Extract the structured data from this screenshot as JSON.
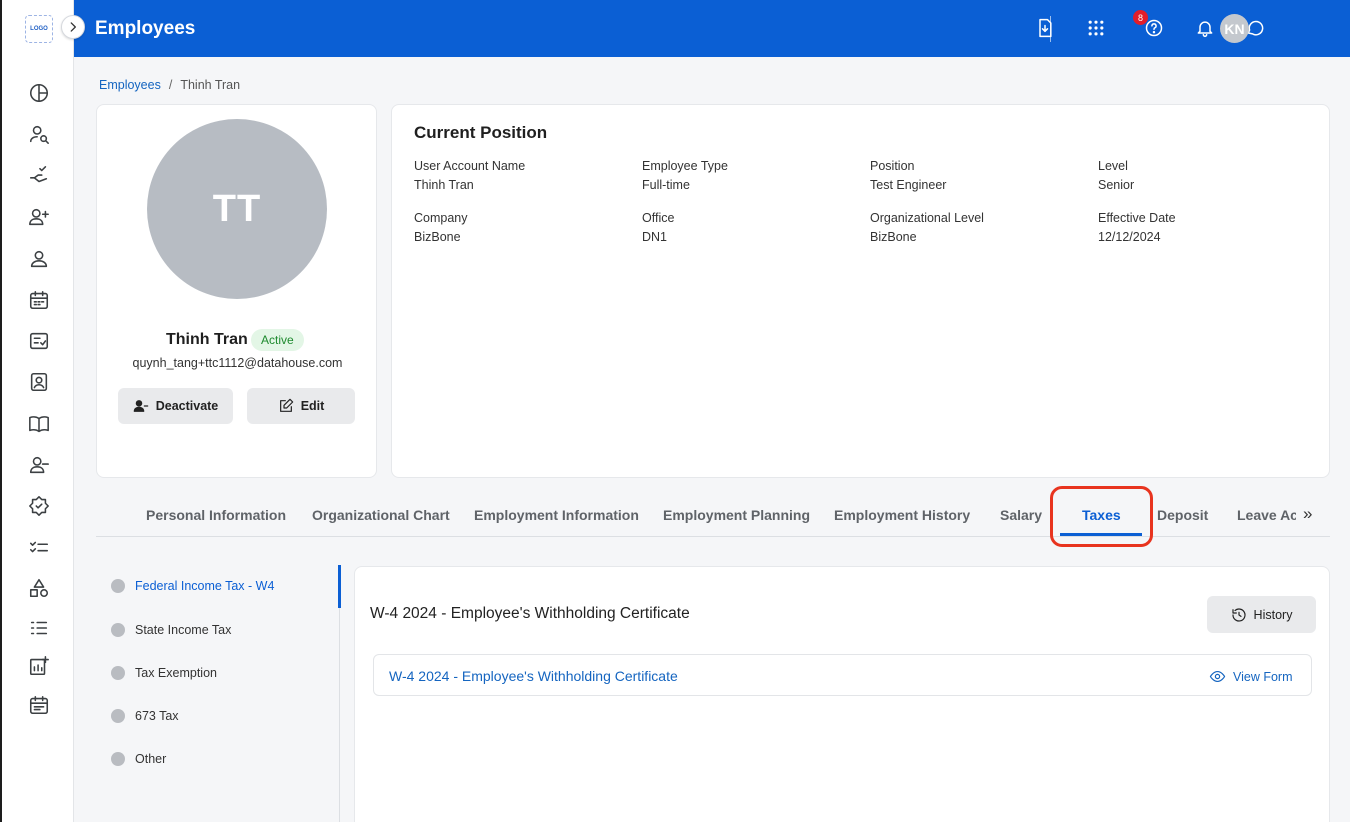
{
  "app": {
    "logo_text": "LOGO",
    "page_title": "Employees",
    "notification_count": "8",
    "user_initials": "KN"
  },
  "sidebar": {
    "icons": [
      "dashboard-icon",
      "user-search-icon",
      "approval-icon",
      "add-user-icon",
      "user-icon",
      "calendar-icon",
      "checklist-icon",
      "id-card-icon",
      "book-icon",
      "remove-user-icon",
      "badge-icon",
      "task-list-icon",
      "shapes-icon",
      "list-check-icon",
      "report-add-icon",
      "schedule-icon"
    ]
  },
  "breadcrumb": {
    "root": "Employees",
    "separator": "/",
    "current": "Thinh Tran"
  },
  "profile": {
    "initials": "TT",
    "name": "Thinh Tran",
    "status": "Active",
    "email": "quynh_tang+ttc1112@datahouse.com",
    "deactivate_label": "Deactivate",
    "edit_label": "Edit"
  },
  "position": {
    "title": "Current Position",
    "fields": [
      {
        "label": "User Account Name",
        "value": "Thinh Tran"
      },
      {
        "label": "Employee Type",
        "value": "Full-time"
      },
      {
        "label": "Position",
        "value": "Test Engineer"
      },
      {
        "label": "Level",
        "value": "Senior"
      },
      {
        "label": "Company",
        "value": "BizBone"
      },
      {
        "label": "Office",
        "value": "DN1"
      },
      {
        "label": "Organizational Level",
        "value": "BizBone"
      },
      {
        "label": "Effective Date",
        "value": "12/12/2024"
      }
    ]
  },
  "tabs": {
    "items": [
      {
        "label": "Personal Information"
      },
      {
        "label": "Organizational Chart"
      },
      {
        "label": "Employment Information"
      },
      {
        "label": "Employment Planning"
      },
      {
        "label": "Employment History"
      },
      {
        "label": "Salary"
      },
      {
        "label": "Taxes"
      },
      {
        "label": "Deposit"
      },
      {
        "label": "Leave Ac"
      }
    ],
    "active": "Taxes",
    "more_symbol": "»"
  },
  "tax_nav": {
    "items": [
      {
        "label": "Federal Income Tax - W4"
      },
      {
        "label": "State Income Tax"
      },
      {
        "label": "Tax Exemption"
      },
      {
        "label": "673 Tax"
      },
      {
        "label": "Other"
      }
    ],
    "active": "Federal Income Tax - W4"
  },
  "content": {
    "title": "W-4 2024 - Employee's Withholding Certificate",
    "history_label": "History",
    "form_name": "W-4 2024 - Employee's Withholding Certificate",
    "view_form_label": "View Form"
  },
  "colors": {
    "brand": "#0b5fd4",
    "highlight": "#e8341f",
    "active_status_bg": "#e3f6e6",
    "active_status_text": "#1e8a2e"
  }
}
